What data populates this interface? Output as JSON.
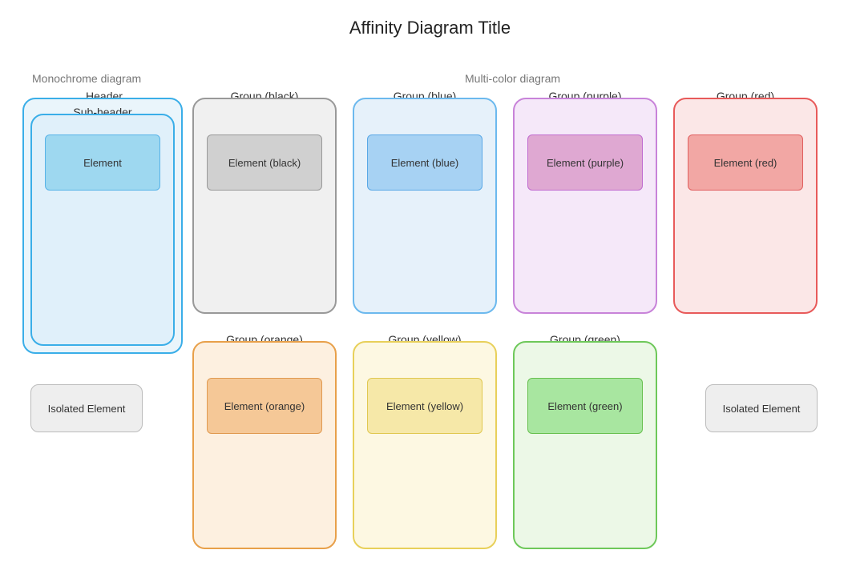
{
  "title": "Affinity Diagram Title",
  "sectionLabels": {
    "mono": "Monochrome diagram",
    "multi": "Multi-color diagram"
  },
  "mono": {
    "headerLabel": "Header",
    "subHeaderLabel": "Sub-header",
    "elementLabel": "Element",
    "isolatedLabel": "Isolated Element"
  },
  "groups": {
    "black": {
      "group": "Group (black)",
      "element": "Element (black)"
    },
    "blue": {
      "group": "Group (blue)",
      "element": "Element (blue)"
    },
    "purple": {
      "group": "Group (purple)",
      "element": "Element (purple)"
    },
    "red": {
      "group": "Group (red)",
      "element": "Element (red)"
    },
    "orange": {
      "group": "Group (orange)",
      "element": "Element (orange)"
    },
    "yellow": {
      "group": "Group (yellow)",
      "element": "Element (yellow)"
    },
    "green": {
      "group": "Group (green)",
      "element": "Element (green)"
    }
  },
  "isolatedRight": "Isolated Element",
  "colors": {
    "blueBorder": "#3aaee8",
    "blueFill": "#e9f3fb",
    "blueElBorder": "#57b3e8",
    "blueElFill": "#9ed8f0",
    "blackBorder": "#999999",
    "blackFill": "#f0f0f0",
    "blackElBorder": "#999999",
    "blackElFill": "#d0d0d0",
    "blue2Border": "#6cb9ee",
    "blue2Fill": "#e6f1fa",
    "blue2ElBorder": "#5aa8e6",
    "blue2ElFill": "#a7d2f3",
    "purpleBorder": "#c883d9",
    "purpleFill": "#f5e8f9",
    "purpleElBorder": "#c06ccf",
    "purpleElFill": "#dfa8d2",
    "redBorder": "#e85a5a",
    "redFill": "#fbe7e7",
    "redElBorder": "#e06060",
    "redElFill": "#f2a7a4",
    "orangeBorder": "#e8a04a",
    "orangeFill": "#fdf0e0",
    "orangeElBorder": "#e09a50",
    "orangeElFill": "#f5c897",
    "yellowBorder": "#e8d05a",
    "yellowFill": "#fdf8e2",
    "yellowElBorder": "#e0c850",
    "yellowElFill": "#f6e8a8",
    "greenBorder": "#6ec85a",
    "greenFill": "#ecf8e7",
    "greenElBorder": "#68c050",
    "greenElFill": "#a8e6a0"
  }
}
